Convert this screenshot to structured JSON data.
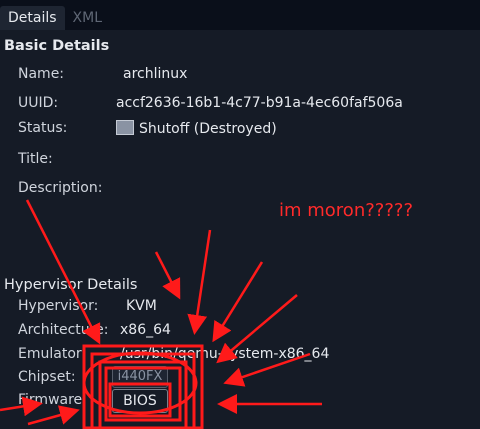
{
  "tabs": [
    {
      "label": "Details",
      "active": true
    },
    {
      "label": "XML",
      "active": false
    }
  ],
  "basic": {
    "title": "Basic Details",
    "name_label": "Name:",
    "name_value": "archlinux",
    "uuid_label": "UUID:",
    "uuid_value": "accf2636-16b1-4c77-b91a-4ec60faf506a",
    "status_label": "Status:",
    "status_value": "Shutoff (Destroyed)",
    "status_icon": "monitor-off-icon",
    "title_label": "Title:",
    "description_label": "Description:"
  },
  "annotation": {
    "text": "im moron?????",
    "color": "#ff2a2a"
  },
  "hypervisor": {
    "title": "Hypervisor Details",
    "hypervisor_label": "Hypervisor:",
    "hypervisor_value": "KVM",
    "architecture_label": "Architecture:",
    "architecture_value": "x86_64",
    "emulator_label": "Emulator:",
    "emulator_value": "/usr/bin/qemu-system-x86_64",
    "chipset_label": "Chipset:",
    "chipset_value": "i440FX",
    "firmware_label": "Firmware:",
    "firmware_value": "BIOS"
  }
}
